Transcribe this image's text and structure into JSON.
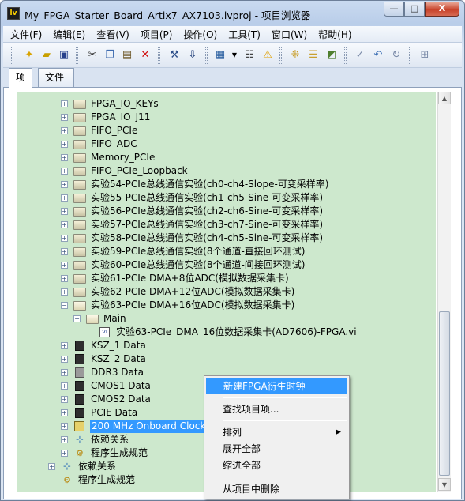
{
  "window": {
    "title": "My_FPGA_Starter_Board_Artix7_AX7103.lvproj - 项目浏览器",
    "app_icon": "labview-project-icon",
    "min_label": "—",
    "max_label": "□",
    "close_label": "X"
  },
  "menu": [
    "文件(F)",
    "编辑(E)",
    "查看(V)",
    "项目(P)",
    "操作(O)",
    "工具(T)",
    "窗口(W)",
    "帮助(H)"
  ],
  "toolbar_icons": [
    "new-file-icon",
    "open-folder-icon",
    "save-all-icon",
    "cut-icon",
    "copy-icon",
    "paste-icon",
    "delete-icon",
    "build-icon",
    "deploy-icon",
    "view-options-icon",
    "properties-icon",
    "warning-icon",
    "expand-all-icon",
    "collapse-all-icon",
    "add-files-icon",
    "checkout-icon",
    "undo-icon",
    "refresh-icon",
    "add-icon"
  ],
  "tabs": [
    "项",
    "文件"
  ],
  "tree": {
    "items": [
      "FPGA_IO_KEYs",
      "FPGA_IO_J11",
      "FIFO_PCIe",
      "FIFO_ADC",
      "Memory_PCIe",
      "FIFO_PCIe_Loopback",
      "实验54-PCIe总线通信实验(ch0-ch4-Slope-可变采样率)",
      "实验55-PCIe总线通信实验(ch1-ch5-Sine-可变采样率)",
      "实验56-PCIe总线通信实验(ch2-ch6-Sine-可变采样率)",
      "实验57-PCIe总线通信实验(ch3-ch7-Sine-可变采样率)",
      "实验58-PCIe总线通信实验(ch4-ch5-Sine-可变采样率)",
      "实验59-PCIe总线通信实验(8个通道-直接回环测试)",
      "实验60-PCIe总线通信实验(8个通道-间接回环测试)",
      "实验61-PCIe DMA+8位ADC(模拟数据采集卡)",
      "实验62-PCIe DMA+12位ADC(模拟数据采集卡)",
      "实验63-PCIe DMA+16位ADC(模拟数据采集卡)",
      "Main",
      "实验63-PCIe_DMA_16位数据采集卡(AD7606)-FPGA.vi",
      "KSZ_1 Data",
      "KSZ_2 Data",
      "DDR3 Data",
      "CMOS1 Data",
      "CMOS2 Data",
      "PCIE Data",
      "200 MHz Onboard Clock",
      "依赖关系",
      "程序生成规范",
      "依赖关系",
      "程序生成规范"
    ]
  },
  "context_menu": {
    "new_derived_clock": "新建FPGA衍生时钟",
    "find_item": "查找项目项...",
    "arrange": "排列",
    "expand_all": "展开全部",
    "collapse_all": "缩进全部",
    "remove": "从项目中删除"
  }
}
